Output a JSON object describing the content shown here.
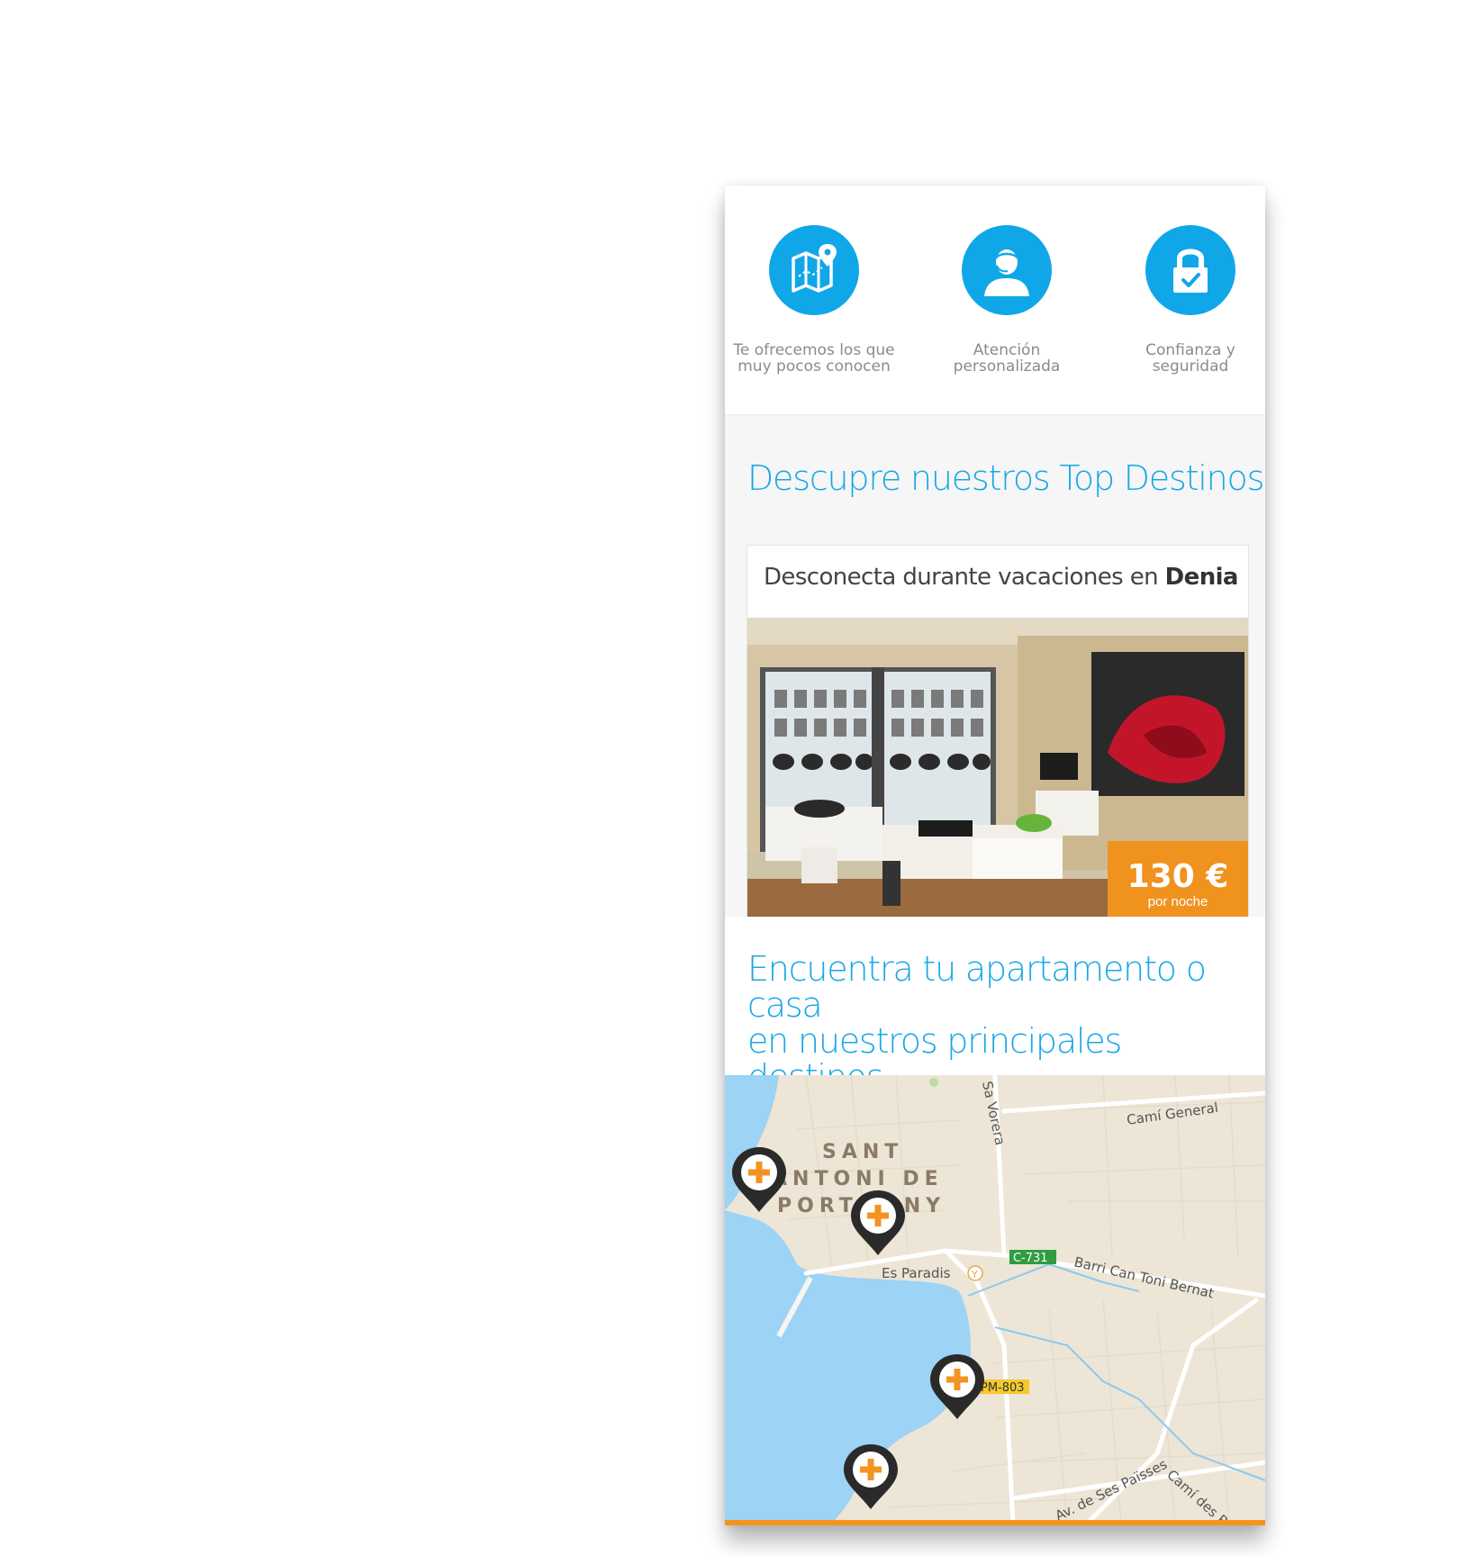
{
  "features": [
    {
      "line1": "Te ofrecemos los que",
      "line2": "muy pocos conocen",
      "icon": "map-pin-icon"
    },
    {
      "line1": "Atención",
      "line2": "personalizada",
      "icon": "support-agent-icon"
    },
    {
      "line1": "Confianza y",
      "line2": "seguridad",
      "icon": "lock-check-icon"
    }
  ],
  "top_destinos": {
    "heading": "Descupre nuestros Top Destinos",
    "card": {
      "title_prefix": "Desconecta durante vacaciones en ",
      "title_city": "Denia",
      "price": "130 €",
      "price_unit": "por noche"
    }
  },
  "encuentra": {
    "line1": "Encuentra tu apartamento o casa",
    "line2": "en nuestros principales destinos"
  },
  "map": {
    "labels": {
      "town1": "SANT",
      "town2": "ANTONI DE",
      "town3": "PORTMANY",
      "sa_vorera": "Sa Vorera",
      "cami_general": "Camí General",
      "es_paradis": "Es Paradis",
      "road_c731": "C-731",
      "barri": "Barri Can Toni Bernat",
      "road_pm803": "PM-803",
      "av_ses_paisses": "Av. de Ses Païsses",
      "cami_des_re": "Camí des Re"
    },
    "colors": {
      "water": "#9dd3f4",
      "land": "#ede5d6",
      "marker": "#2a2a2a",
      "plus": "#f39321"
    }
  },
  "colors": {
    "accent": "#10a7e9",
    "orange": "#f0921e"
  }
}
